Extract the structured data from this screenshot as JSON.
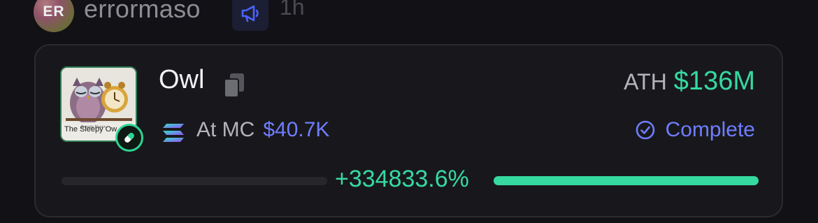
{
  "post": {
    "avatar_initials": "ER",
    "username": "errormaso",
    "time": "1h",
    "announcement_icon": "megaphone-icon"
  },
  "token": {
    "name": "Owl",
    "image_text": "The Sleepy Ow",
    "image_icon": "owl-clock-thumbnail",
    "badge_icon": "pill-icon",
    "copy_icon": "copy-icon",
    "chain_icon": "solana-icon",
    "ath_label": "ATH",
    "ath_value": "$136M",
    "mc_label": "At MC",
    "mc_value": "$40.7K",
    "status_icon": "check-circle-icon",
    "status": "Complete",
    "gain": "+334833.6%"
  },
  "colors": {
    "background": "#121216",
    "card": "#18181c",
    "green": "#36d9a0",
    "blue": "#6f7dff",
    "muted": "#b4b4bc"
  }
}
